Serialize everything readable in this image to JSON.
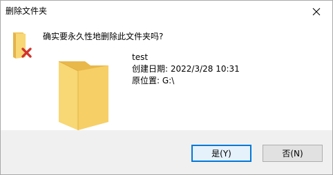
{
  "window": {
    "title": "删除文件夹"
  },
  "message": {
    "question": "确实要永久性地删除此文件夹吗?"
  },
  "item": {
    "name": "test",
    "created": "创建日期: 2022/3/28 10:31",
    "location": "原位置: G:\\"
  },
  "buttons": {
    "yes_label": "是(Y)",
    "no_label": "否(N)"
  },
  "icons": {
    "close": "close-icon",
    "folder": "folder-icon",
    "delete": "red-x-icon"
  },
  "colors": {
    "folder_light": "#f8d775",
    "folder_dark": "#e8b84a",
    "delete_red": "#d1342b",
    "accent": "#0078d7"
  }
}
